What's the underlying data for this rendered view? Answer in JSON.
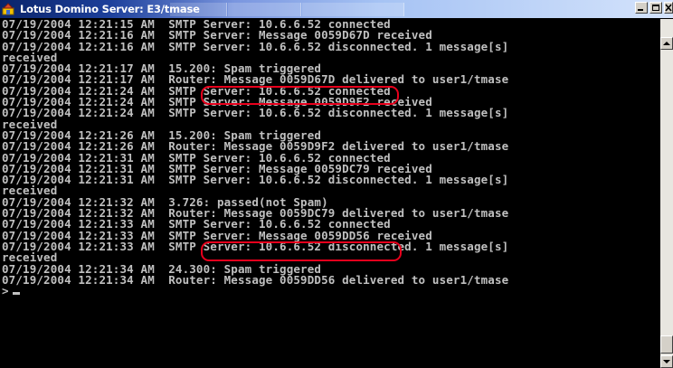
{
  "window": {
    "title": "Lotus Domino Server: E3/tmase",
    "icon": "lotus-domino-app-icon",
    "controls": [
      "minimize-icon",
      "restore-icon",
      "close-icon"
    ]
  },
  "console": {
    "lines": [
      "07/19/2004 12:21:15 AM  SMTP Server: 10.6.6.52 connected",
      "07/19/2004 12:21:16 AM  SMTP Server: Message 0059D67D received",
      "07/19/2004 12:21:16 AM  SMTP Server: 10.6.6.52 disconnected. 1 message[s]",
      "received",
      "07/19/2004 12:21:17 AM  15.200: Spam triggered",
      "07/19/2004 12:21:17 AM  Router: Message 0059D67D delivered to user1/tmase",
      "07/19/2004 12:21:24 AM  SMTP Server: 10.6.6.52 connected",
      "07/19/2004 12:21:24 AM  SMTP Server: Message 0059D9F2 received",
      "07/19/2004 12:21:24 AM  SMTP Server: 10.6.6.52 disconnected. 1 message[s]",
      "received",
      "07/19/2004 12:21:26 AM  15.200: Spam triggered",
      "07/19/2004 12:21:26 AM  Router: Message 0059D9F2 delivered to user1/tmase",
      "07/19/2004 12:21:31 AM  SMTP Server: 10.6.6.52 connected",
      "07/19/2004 12:21:31 AM  SMTP Server: Message 0059DC79 received",
      "07/19/2004 12:21:31 AM  SMTP Server: 10.6.6.52 disconnected. 1 message[s]",
      "received",
      "07/19/2004 12:21:32 AM  3.726: passed(not Spam)",
      "07/19/2004 12:21:32 AM  Router: Message 0059DC79 delivered to user1/tmase",
      "07/19/2004 12:21:33 AM  SMTP Server: 10.6.6.52 connected",
      "07/19/2004 12:21:33 AM  SMTP Server: Message 0059DD56 received",
      "07/19/2004 12:21:33 AM  SMTP Server: 10.6.6.52 disconnected. 1 message[s]",
      "received",
      "07/19/2004 12:21:34 AM  24.300: Spam triggered",
      "07/19/2004 12:21:34 AM  Router: Message 0059DD56 delivered to user1/tmase"
    ],
    "prompt": ">",
    "highlight_color": "#e8001c",
    "text_color": "#c0c0c0",
    "background_color": "#000000"
  }
}
